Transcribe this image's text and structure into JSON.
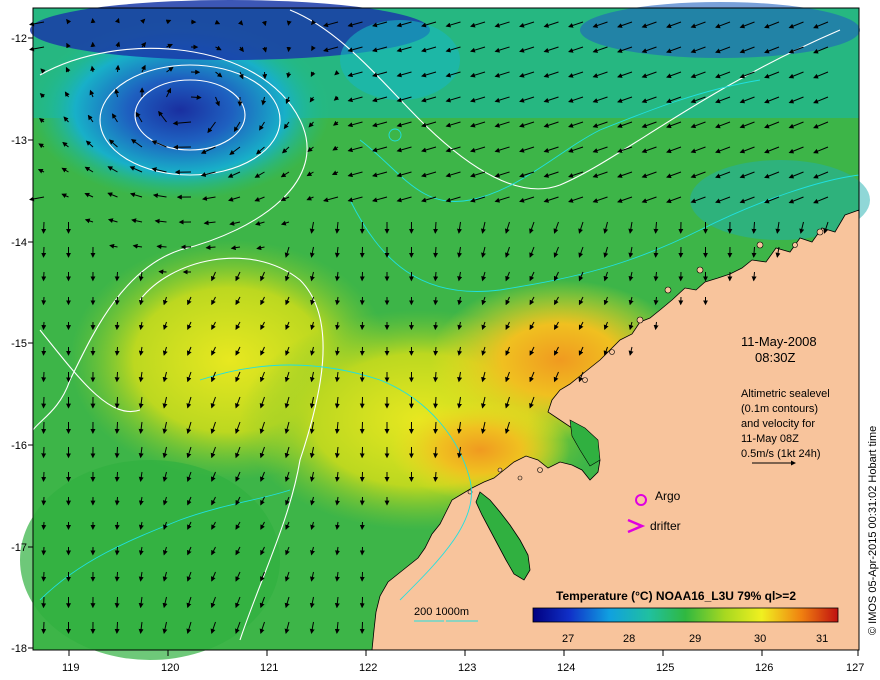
{
  "map": {
    "date": "11-May-2008",
    "time": "08:30Z",
    "notes": [
      "Altimetric sealevel",
      "(0.1m contours)",
      "and velocity for",
      "11-May 08Z",
      "0.5m/s (1kt 24h)"
    ],
    "markers": {
      "argo": "Argo",
      "drifter": "drifter",
      "argo_color": "#e000e0"
    },
    "bathymetry_label": "200  1000m",
    "colorbar": {
      "title": "Temperature (°C) NOAA16_L3U 79% ql>=2",
      "ticks": [
        "27",
        "28",
        "29",
        "30",
        "31"
      ]
    },
    "copyright": "© IMOS 05-Apr-2015 00:31:02 Hobart time",
    "xticks": [
      "119",
      "120",
      "121",
      "122",
      "123",
      "124",
      "125",
      "126",
      "127"
    ],
    "yticks": [
      "-12",
      "-13",
      "-14",
      "-15",
      "-16",
      "-17",
      "-18"
    ],
    "colors": {
      "land": "#f8c49c",
      "sst_cold": "#1a2fa0",
      "sst_cool": "#15c0c8",
      "sst_mid": "#3cb44b",
      "sst_warm": "#d8e01a",
      "sst_hot": "#f0a020"
    }
  }
}
